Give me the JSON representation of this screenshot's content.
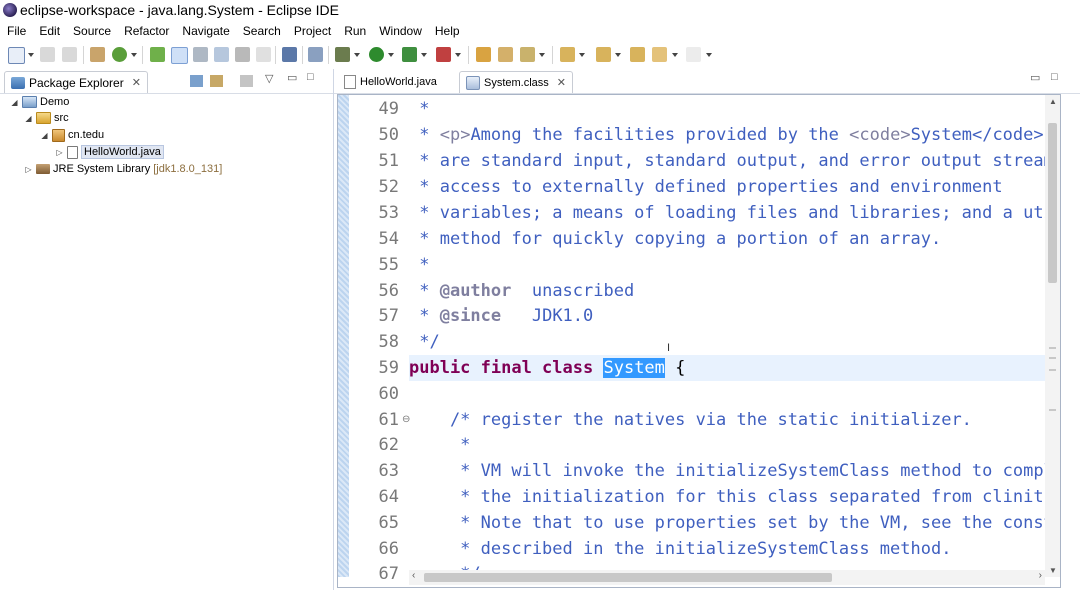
{
  "window": {
    "title": "eclipse-workspace - java.lang.System - Eclipse IDE"
  },
  "menu": [
    "File",
    "Edit",
    "Source",
    "Refactor",
    "Navigate",
    "Search",
    "Project",
    "Run",
    "Window",
    "Help"
  ],
  "package_explorer": {
    "tab_label": "Package Explorer",
    "tree": [
      {
        "label": "Demo",
        "icon": "project-icon",
        "twisty": "◢",
        "indent": 0
      },
      {
        "label": "src",
        "icon": "source-folder-icon",
        "twisty": "◢",
        "indent": 1
      },
      {
        "label": "cn.tedu",
        "icon": "package-icon",
        "twisty": "◢",
        "indent": 2
      },
      {
        "label": "HelloWorld.java",
        "icon": "java-file-icon",
        "twisty": "▷",
        "indent": 3,
        "selected": true
      },
      {
        "label": "JRE System Library",
        "icon": "library-icon",
        "twisty": "▷",
        "indent": 1,
        "decoration": "[jdk1.8.0_131]"
      }
    ]
  },
  "editor": {
    "tabs": [
      {
        "label": "HelloWorld.java",
        "active": false,
        "icon": "java-file-icon"
      },
      {
        "label": "System.class",
        "active": true,
        "icon": "class-file-icon"
      }
    ],
    "line_numbers": [
      "49",
      "50",
      "51",
      "52",
      "53",
      "54",
      "55",
      "56",
      "57",
      "58",
      "59",
      "60",
      "61",
      "62",
      "63",
      "64",
      "65",
      "66",
      "67"
    ],
    "code": {
      "l49": " *",
      "l50a": " * ",
      "l50b": "<p>",
      "l50c": "Among the facilities provided by the ",
      "l50d": "<code>",
      "l50e": "System</code> class",
      "l51": " * are standard input, standard output, and error output streams;",
      "l52": " * access to externally defined properties and environment",
      "l53": " * variables; a means of loading files and libraries; and a utility",
      "l54": " * method for quickly copying a portion of an array.",
      "l55": " *",
      "l56a": " * ",
      "l56b": "@author",
      "l56c": "  unascribed",
      "l57a": " * ",
      "l57b": "@since",
      "l57c": "   JDK1.0",
      "l58": " */",
      "l59a": "public final class",
      "l59b": " ",
      "l59c": "System",
      "l59d": " {",
      "l60": "",
      "l61": "    /* register the natives via the static initializer.",
      "l62": "     *",
      "l63": "     * VM will invoke the initializeSystemClass method to complete",
      "l64": "     * the initialization for this class separated from clinit.",
      "l65": "     * Note that to use properties set by the VM, see the constraints",
      "l66": "     * described in the initializeSystemClass method.",
      "l67": "     */"
    },
    "fold_marker": "⊖"
  },
  "colors": {
    "keyword": "#7f0055",
    "comment": "#3f5fbf",
    "javadoc_tag": "#7f7f9f",
    "selection": "#3399ff"
  }
}
